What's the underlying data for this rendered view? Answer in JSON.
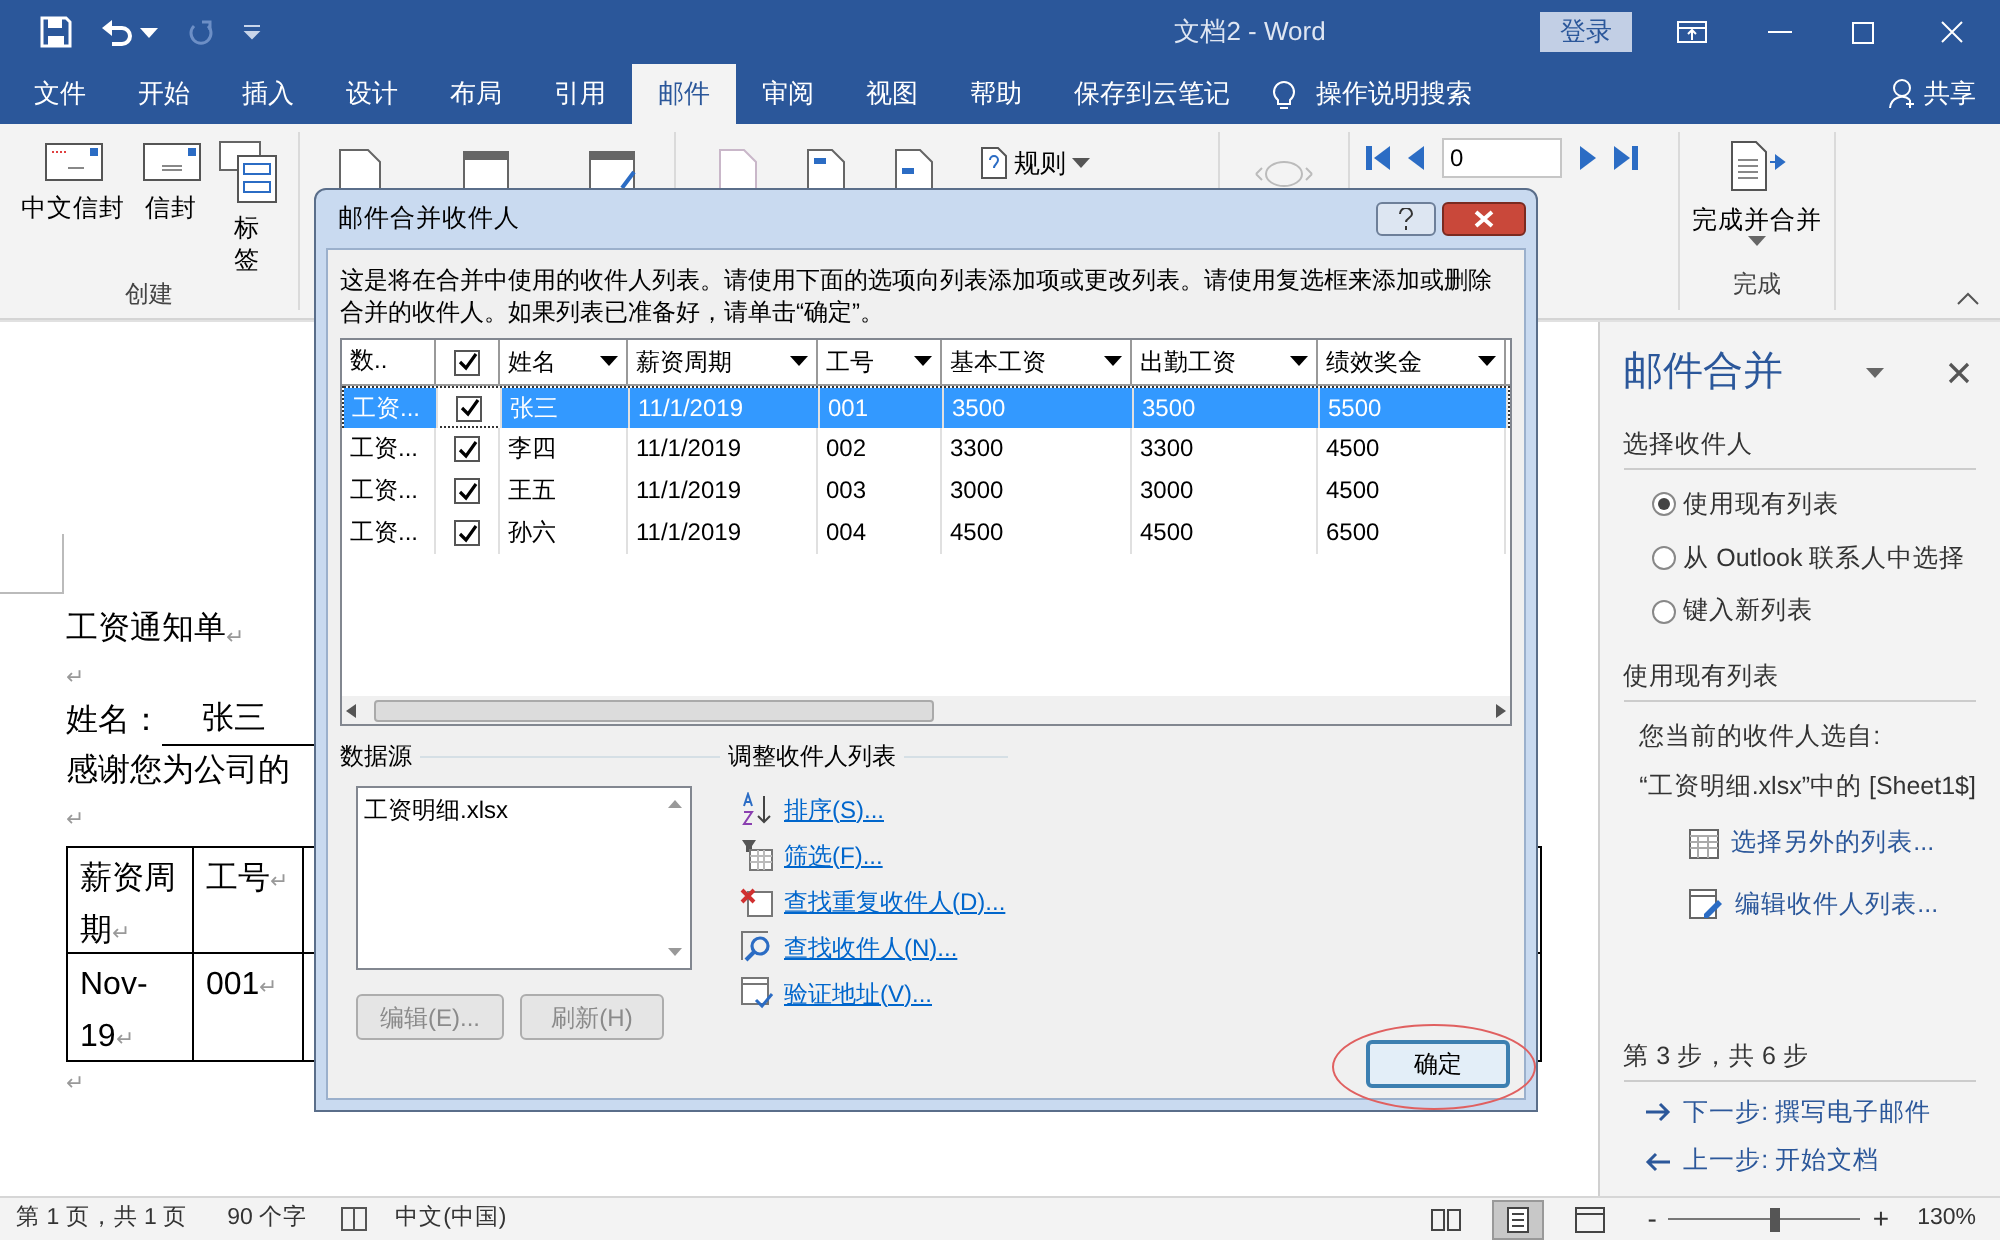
{
  "titlebar": {
    "title": "文档2 - Word",
    "login": "登录"
  },
  "tabs": [
    {
      "label": "文件",
      "selected": false
    },
    {
      "label": "开始",
      "selected": false
    },
    {
      "label": "插入",
      "selected": false
    },
    {
      "label": "设计",
      "selected": false
    },
    {
      "label": "布局",
      "selected": false
    },
    {
      "label": "引用",
      "selected": false
    },
    {
      "label": "邮件",
      "selected": true
    },
    {
      "label": "审阅",
      "selected": false
    },
    {
      "label": "视图",
      "selected": false
    },
    {
      "label": "帮助",
      "selected": false
    },
    {
      "label": "保存到云笔记",
      "selected": false
    }
  ],
  "tell_me": "操作说明搜索",
  "share": "共享",
  "ribbon": {
    "create_group": {
      "label": "创建",
      "buttons": [
        "中文信封",
        "信封",
        "标签"
      ]
    },
    "rules": "规则",
    "record": "0",
    "finish": {
      "label": "完成并合并",
      "group": "完成"
    }
  },
  "document": {
    "heading": {
      "text": "工资通知单",
      "mark": "↵"
    },
    "blank1": "↵",
    "name_label": "姓名：",
    "name_value": "张三",
    "thanks": "感谢您为公司的",
    "blank2": "↵",
    "table": {
      "header": [
        {
          "text": "薪资周期",
          "mark": "↵"
        },
        {
          "text": "工号",
          "mark": "↵"
        }
      ],
      "row": [
        {
          "text": "Nov-19",
          "mark": "↵"
        },
        {
          "text": "001",
          "mark": "↵"
        }
      ]
    },
    "blank3": "↵"
  },
  "dialog": {
    "title": "邮件合并收件人",
    "description": "这是将在合并中使用的收件人列表。请使用下面的选项向列表添加项或更改列表。请使用复选框来添加或删除合并的收件人。如果列表已准备好，请单击“确定”。",
    "columns": [
      {
        "kind": "text",
        "label": "数.."
      },
      {
        "kind": "checkbox",
        "checked": true
      },
      {
        "kind": "text",
        "label": "姓名"
      },
      {
        "kind": "text",
        "label": "薪资周期"
      },
      {
        "kind": "text",
        "label": "工号"
      },
      {
        "kind": "text",
        "label": "基本工资"
      },
      {
        "kind": "text",
        "label": "出勤工资"
      },
      {
        "kind": "text",
        "label": "绩效奖金"
      }
    ],
    "rows": [
      {
        "selected": true,
        "cells": [
          {
            "kind": "text",
            "text": "工资..."
          },
          {
            "kind": "checkbox",
            "checked": true
          },
          {
            "kind": "text",
            "text": "张三"
          },
          {
            "kind": "text",
            "text": "11/1/2019"
          },
          {
            "kind": "text",
            "text": "001"
          },
          {
            "kind": "text",
            "text": "3500"
          },
          {
            "kind": "text",
            "text": "3500"
          },
          {
            "kind": "text",
            "text": "5500"
          }
        ]
      },
      {
        "selected": false,
        "cells": [
          {
            "kind": "text",
            "text": "工资..."
          },
          {
            "kind": "checkbox",
            "checked": true
          },
          {
            "kind": "text",
            "text": "李四"
          },
          {
            "kind": "text",
            "text": "11/1/2019"
          },
          {
            "kind": "text",
            "text": "002"
          },
          {
            "kind": "text",
            "text": "3300"
          },
          {
            "kind": "text",
            "text": "3300"
          },
          {
            "kind": "text",
            "text": "4500"
          }
        ]
      },
      {
        "selected": false,
        "cells": [
          {
            "kind": "text",
            "text": "工资..."
          },
          {
            "kind": "checkbox",
            "checked": true
          },
          {
            "kind": "text",
            "text": "王五"
          },
          {
            "kind": "text",
            "text": "11/1/2019"
          },
          {
            "kind": "text",
            "text": "003"
          },
          {
            "kind": "text",
            "text": "3000"
          },
          {
            "kind": "text",
            "text": "3000"
          },
          {
            "kind": "text",
            "text": "4500"
          }
        ]
      },
      {
        "selected": false,
        "cells": [
          {
            "kind": "text",
            "text": "工资..."
          },
          {
            "kind": "checkbox",
            "checked": true
          },
          {
            "kind": "text",
            "text": "孙六"
          },
          {
            "kind": "text",
            "text": "11/1/2019"
          },
          {
            "kind": "text",
            "text": "004"
          },
          {
            "kind": "text",
            "text": "4500"
          },
          {
            "kind": "text",
            "text": "4500"
          },
          {
            "kind": "text",
            "text": "6500"
          }
        ]
      }
    ],
    "source_label": "数据源",
    "sources": [
      "工资明细.xlsx"
    ],
    "source_buttons": [
      {
        "label": "编辑(E)...",
        "disabled": true
      },
      {
        "label": "刷新(H)",
        "disabled": true
      }
    ],
    "refine_label": "调整收件人列表",
    "links": [
      {
        "kind": "sort",
        "label": "排序(S)..."
      },
      {
        "kind": "filter",
        "label": "筛选(F)..."
      },
      {
        "kind": "duplicates",
        "label": "查找重复收件人(D)..."
      },
      {
        "kind": "find",
        "label": "查找收件人(N)..."
      },
      {
        "kind": "validate",
        "label": "验证地址(V)..."
      }
    ],
    "ok": "确定"
  },
  "pane": {
    "title": "邮件合并",
    "section1": "选择收件人",
    "options": [
      {
        "label": "使用现有列表",
        "selected": true
      },
      {
        "label": "从 Outlook 联系人中选择",
        "selected": false
      },
      {
        "label": "键入新列表",
        "selected": false
      }
    ],
    "section2": "使用现有列表",
    "current": "您当前的收件人选自:",
    "source": "“工资明细.xlsx”中的 [Sheet1$]",
    "actions": [
      {
        "kind": "choose",
        "label": "选择另外的列表..."
      },
      {
        "kind": "edit",
        "label": "编辑收件人列表..."
      }
    ],
    "step": "第 3 步，共 6 步",
    "next": "下一步: 撰写电子邮件",
    "prev": "上一步: 开始文档"
  },
  "status_bar": {
    "page": "第 1 页，共 1 页",
    "words": "90 个字",
    "language": "中文(中国)",
    "views": [
      {
        "kind": "read",
        "selected": false
      },
      {
        "kind": "print",
        "selected": true
      },
      {
        "kind": "web",
        "selected": false
      }
    ],
    "zoom_out": "-",
    "zoom_in": "+",
    "zoom": {
      "level": 0.55
    },
    "zoom_text": "130%"
  }
}
